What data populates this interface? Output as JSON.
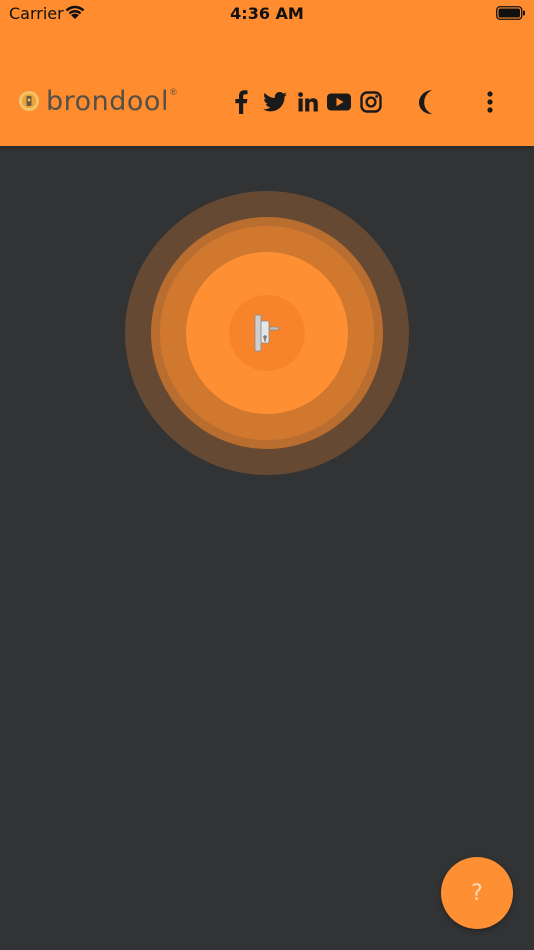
{
  "status_bar": {
    "carrier": "Carrier",
    "time": "4:36 AM"
  },
  "header": {
    "brand_name": "brondool",
    "brand_reg": "®",
    "social_icons": [
      "facebook-icon",
      "twitter-icon",
      "linkedin-icon",
      "youtube-icon",
      "instagram-icon"
    ],
    "theme_icon": "moon-icon",
    "menu_icon": "more-vertical-icon"
  },
  "main": {
    "center_icon": "door-lock-icon"
  },
  "fab": {
    "label": "?"
  },
  "colors": {
    "accent": "#ff8c2e",
    "background": "#323334",
    "header_icons": "#1a1a1a",
    "brand_text": "#555047"
  }
}
